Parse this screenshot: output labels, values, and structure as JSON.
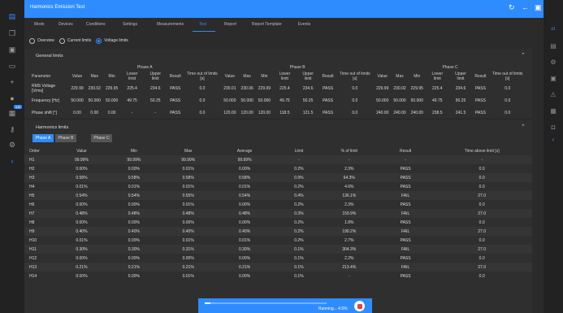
{
  "app": {
    "title": "Harmonics Emission Test"
  },
  "leftbar": {
    "icons": [
      "document-icon",
      "copy-icon",
      "book-icon",
      "device-icon",
      "plus-icon",
      "settings-icon",
      "database-icon",
      "key-icon",
      "gear-icon",
      "chevron-right-icon"
    ],
    "badge": "1.8"
  },
  "rightbar": {
    "label": "d1"
  },
  "tabs": [
    "Mode",
    "Devices",
    "Conditions",
    "Settings",
    "Measurements",
    "Test",
    "Report",
    "Report Template",
    "Events"
  ],
  "active_tab": "Test",
  "radio": {
    "overview": "Overview",
    "current": "Current limits",
    "voltage": "Voltage limits"
  },
  "general_limits": {
    "title": "General limits",
    "phases": [
      "Phase A",
      "Phase B",
      "Phase C"
    ],
    "columns": [
      "Parameter",
      "Value",
      "Max",
      "Min",
      "Lower limit",
      "Upper limit",
      "Result",
      "Time out of limits [s]"
    ],
    "rows": [
      {
        "param": "RMS Voltage [Vrms]",
        "a": [
          "229.99",
          "230.02",
          "229.95",
          "225.4",
          "234.6",
          "PASS",
          "0.0"
        ],
        "b": [
          "230.01",
          "230.06",
          "229.99",
          "225.4",
          "234.6",
          "PASS",
          "0.0"
        ],
        "c": [
          "229.99",
          "230.02",
          "229.95",
          "225.4",
          "234.6",
          "PASS",
          "0.0"
        ]
      },
      {
        "param": "Frequency [Hz]",
        "a": [
          "50.000",
          "50.000",
          "50.000",
          "49.75",
          "50.25",
          "PASS",
          "0.0"
        ],
        "b": [
          "50.000",
          "50.000",
          "50.000",
          "49.75",
          "50.25",
          "PASS",
          "0.0"
        ],
        "c": [
          "50.000",
          "50.000",
          "50.000",
          "49.75",
          "50.25",
          "PASS",
          "0.0"
        ]
      },
      {
        "param": "Phase shift [°]",
        "a": [
          "0.00",
          "0.00",
          "0.00",
          "-",
          "-",
          "PASS",
          "0.0"
        ],
        "b": [
          "120.00",
          "120.00",
          "120.00",
          "118.5",
          "121.5",
          "PASS",
          "0.0"
        ],
        "c": [
          "240.00",
          "240.00",
          "240.00",
          "238.5",
          "241.5",
          "PASS",
          "0.0"
        ]
      }
    ]
  },
  "harmonics": {
    "title": "Harmonics limits",
    "phase_tabs": [
      "Phase A",
      "Phase B",
      "Phase C"
    ],
    "columns": [
      "Order",
      "Value",
      "Min",
      "Max",
      "Average",
      "Limit",
      "% of limit",
      "Result",
      "Time above limit [s]"
    ],
    "rows": [
      [
        "H1",
        "99.99%",
        "99.99%",
        "99.99%",
        "99.99%",
        "-",
        "-",
        "-",
        "-"
      ],
      [
        "H2",
        "0.00%",
        "0.00%",
        "0.01%",
        "0.00%",
        "0.2%",
        "2.3%",
        "PASS",
        "0.0"
      ],
      [
        "H3",
        "0.58%",
        "0.58%",
        "0.58%",
        "0.58%",
        "0.9%",
        "64.3%",
        "PASS",
        "0.0"
      ],
      [
        "H4",
        "0.01%",
        "0.01%",
        "0.01%",
        "0.01%",
        "0.2%",
        "4.6%",
        "PASS",
        "0.0"
      ],
      [
        "H5",
        "0.54%",
        "0.54%",
        "0.55%",
        "0.54%",
        "0.4%",
        "136.1%",
        "FAIL",
        "27.0"
      ],
      [
        "H6",
        "0.00%",
        "0.00%",
        "0.01%",
        "0.00%",
        "0.2%",
        "2.3%",
        "PASS",
        "0.0"
      ],
      [
        "H7",
        "0.48%",
        "0.48%",
        "0.48%",
        "0.48%",
        "0.3%",
        "159.9%",
        "FAIL",
        "27.0"
      ],
      [
        "H8",
        "0.00%",
        "0.00%",
        "0.00%",
        "0.00%",
        "0.2%",
        "1.8%",
        "PASS",
        "0.0"
      ],
      [
        "H9",
        "0.40%",
        "0.40%",
        "0.40%",
        "0.40%",
        "0.2%",
        "199.2%",
        "FAIL",
        "27.0"
      ],
      [
        "H10",
        "0.01%",
        "0.00%",
        "0.01%",
        "0.01%",
        "0.2%",
        "2.7%",
        "PASS",
        "0.0"
      ],
      [
        "H11",
        "0.30%",
        "0.30%",
        "0.31%",
        "0.30%",
        "0.1%",
        "304.3%",
        "FAIL",
        "27.0"
      ],
      [
        "H12",
        "0.00%",
        "0.00%",
        "0.00%",
        "0.00%",
        "0.1%",
        "2.2%",
        "PASS",
        "0.0"
      ],
      [
        "H13",
        "0.21%",
        "0.21%",
        "0.21%",
        "0.21%",
        "0.1%",
        "213.4%",
        "FAIL",
        "27.0"
      ],
      [
        "H14",
        "0.00%",
        "0.00%",
        "0.01%",
        "0.00%",
        "0.1%",
        "-",
        "PASS",
        "0.0"
      ]
    ]
  },
  "progress": {
    "label": "Running... 4.5%",
    "fraction": 0.045
  },
  "colors": {
    "accent": "#2f8cff",
    "pass": "#22b04b",
    "fail": "#e04545"
  }
}
